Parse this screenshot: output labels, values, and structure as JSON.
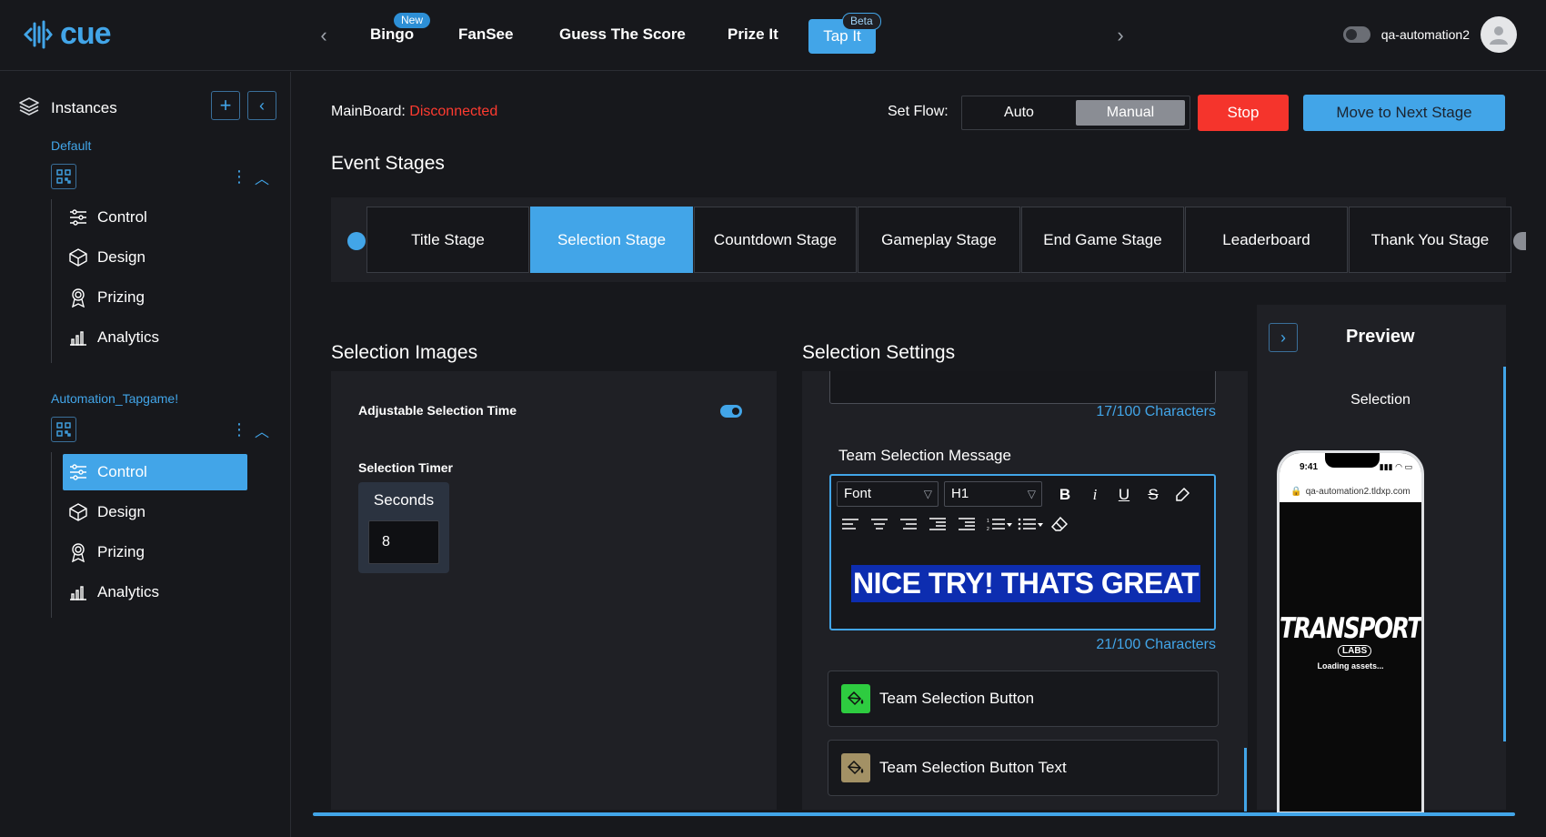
{
  "app": {
    "logo_text": "cue"
  },
  "nav": {
    "tabs": [
      {
        "label": "Bingo",
        "badge": "New"
      },
      {
        "label": "FanSee"
      },
      {
        "label": "Guess The Score"
      },
      {
        "label": "Prize It"
      },
      {
        "label": "Tap It",
        "badge": "Beta",
        "active": true
      }
    ]
  },
  "user": {
    "name": "qa-automation2"
  },
  "sidebar": {
    "title": "Instances",
    "groups": [
      {
        "label": "Default",
        "items": [
          "Control",
          "Design",
          "Prizing",
          "Analytics"
        ]
      },
      {
        "label": "Automation_Tapgame!",
        "items": [
          "Control",
          "Design",
          "Prizing",
          "Analytics"
        ],
        "active_item": "Control"
      }
    ]
  },
  "header": {
    "mainboard_label": "MainBoard:",
    "mainboard_status": "Disconnected",
    "set_flow_label": "Set Flow:",
    "flow_auto": "Auto",
    "flow_manual": "Manual",
    "flow_selected": "Manual",
    "stop_label": "Stop",
    "next_label": "Move to Next Stage"
  },
  "stages": {
    "title": "Event Stages",
    "items": [
      "Title Stage",
      "Selection Stage",
      "Countdown Stage",
      "Gameplay Stage",
      "End Game Stage",
      "Leaderboard",
      "Thank You Stage"
    ],
    "active": "Selection Stage"
  },
  "selection_images": {
    "title": "Selection Images",
    "adjustable_label": "Adjustable Selection Time",
    "adjustable_on": true,
    "timer_label": "Selection Timer",
    "seconds_label": "Seconds",
    "seconds_value": "8"
  },
  "selection_settings": {
    "title": "Selection Settings",
    "char_count_1": "17/100 Characters",
    "message_label": "Team Selection Message",
    "font_select": "Font",
    "heading_select": "H1",
    "message_text": "NICE TRY! THATS GREAT",
    "char_count_2": "21/100 Characters",
    "button_label": "Team Selection Button",
    "button_text_label": "Team Selection Button Text",
    "colors": {
      "button_swatch": "#2ecc40",
      "button_text_swatch": "#a39165"
    }
  },
  "preview": {
    "title": "Preview",
    "stage_label": "Selection",
    "phone_time": "9:41",
    "phone_url": "qa-automation2.tldxp.com",
    "brand_text": "TRANSPORTED",
    "brand_sub": "LABS",
    "loading_text": "Loading assets..."
  }
}
